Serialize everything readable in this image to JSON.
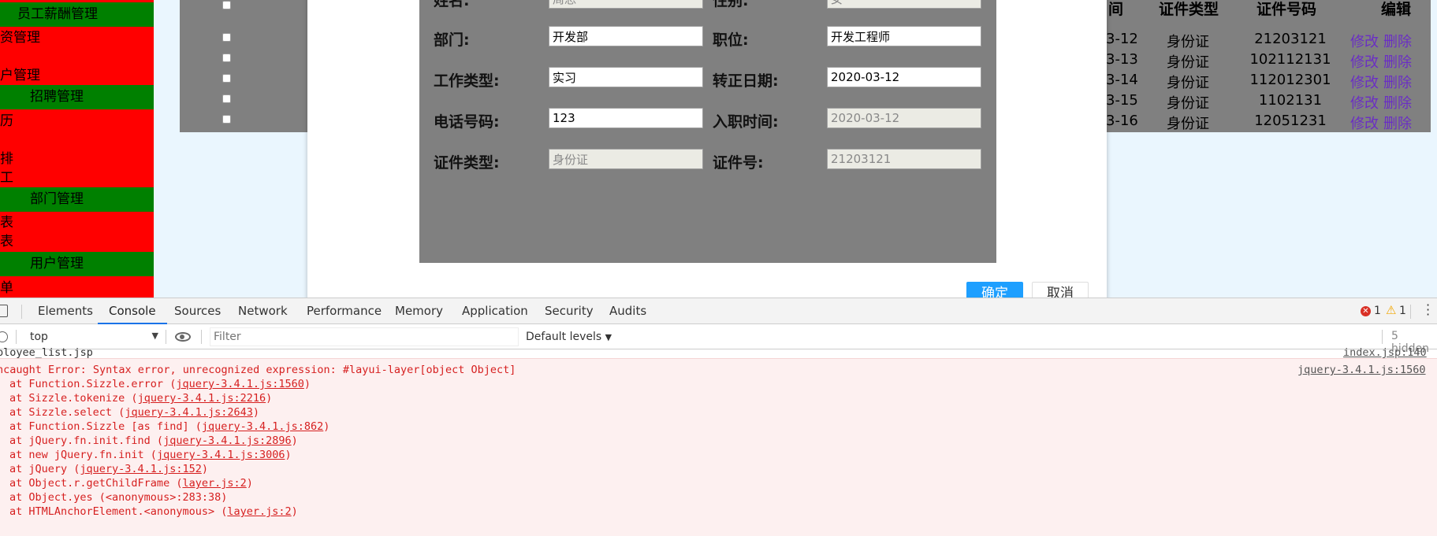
{
  "sidebar": {
    "items": [
      {
        "label": "员工薪酬管理",
        "type": "group"
      },
      {
        "label": "资管理",
        "type": "item"
      },
      {
        "label": "",
        "type": "item"
      },
      {
        "label": "户管理",
        "type": "item"
      },
      {
        "label": "招聘管理",
        "type": "group"
      },
      {
        "label": "历",
        "type": "item"
      },
      {
        "label": "",
        "type": "item"
      },
      {
        "label": "排",
        "type": "item"
      },
      {
        "label": "工",
        "type": "item"
      },
      {
        "label": "部门管理",
        "type": "group"
      },
      {
        "label": "表",
        "type": "item"
      },
      {
        "label": "表",
        "type": "item"
      },
      {
        "label": "用户管理",
        "type": "group"
      },
      {
        "label": "单",
        "type": "item"
      }
    ]
  },
  "table": {
    "headers": {
      "date_tail": "间",
      "id_type": "证件类型",
      "id_no": "证件号码",
      "edit": "编辑"
    },
    "rows": [
      {
        "date_tail": "3-12",
        "id_type": "身份证",
        "id_no": "21203121",
        "edit": "修改",
        "del": "删除"
      },
      {
        "date_tail": "3-13",
        "id_type": "身份证",
        "id_no": "102112131",
        "edit": "修改",
        "del": "删除"
      },
      {
        "date_tail": "3-14",
        "id_type": "身份证",
        "id_no": "112012301",
        "edit": "修改",
        "del": "删除"
      },
      {
        "date_tail": "3-15",
        "id_type": "身份证",
        "id_no": "1102131",
        "edit": "修改",
        "del": "删除"
      },
      {
        "date_tail": "3-16",
        "id_type": "身份证",
        "id_no": "12051231",
        "edit": "修改",
        "del": "删除"
      }
    ]
  },
  "form": {
    "name_label": "姓名:",
    "name_value": "周恐",
    "gender_label": "性别:",
    "gender_value": "女",
    "dept_label": "部门:",
    "dept_value": "开发部",
    "position_label": "职位:",
    "position_value": "开发工程师",
    "worktype_label": "工作类型:",
    "worktype_value": "实习",
    "regular_label": "转正日期:",
    "regular_value": "2020-03-12",
    "phone_label": "电话号码:",
    "phone_value": "123",
    "hire_label": "入职时间:",
    "hire_value": "2020-03-12",
    "idtype_label": "证件类型:",
    "idtype_value": "身份证",
    "idno_label": "证件号:",
    "idno_value": "21203121",
    "ok_label": "确定",
    "cancel_label": "取消"
  },
  "devtools": {
    "tabs": [
      "Elements",
      "Console",
      "Sources",
      "Network",
      "Performance",
      "Memory",
      "Application",
      "Security",
      "Audits"
    ],
    "active_tab": "Console",
    "error_count": "1",
    "warning_count": "1",
    "context": "top",
    "filter_placeholder": "Filter",
    "levels": "Default levels",
    "hidden": "5 hidden",
    "prev_line": "ployee_list.jsp",
    "prev_link": "index.jsp:140",
    "error_message": "ncaught Error: Syntax error, unrecognized expression: #layui-layer[object Object]",
    "error_link": "jquery-3.4.1.js:1560",
    "stack": [
      {
        "text": "at Function.Sizzle.error (",
        "link": "jquery-3.4.1.js:1560",
        "end": ")"
      },
      {
        "text": "at Sizzle.tokenize (",
        "link": "jquery-3.4.1.js:2216",
        "end": ")"
      },
      {
        "text": "at Sizzle.select (",
        "link": "jquery-3.4.1.js:2643",
        "end": ")"
      },
      {
        "text": "at Function.Sizzle [as find] (",
        "link": "jquery-3.4.1.js:862",
        "end": ")"
      },
      {
        "text": "at jQuery.fn.init.find (",
        "link": "jquery-3.4.1.js:2896",
        "end": ")"
      },
      {
        "text": "at new jQuery.fn.init (",
        "link": "jquery-3.4.1.js:3006",
        "end": ")"
      },
      {
        "text": "at jQuery (",
        "link": "jquery-3.4.1.js:152",
        "end": ")"
      },
      {
        "text": "at Object.r.getChildFrame (",
        "link": "layer.js:2",
        "end": ")"
      },
      {
        "text": "at Object.yes (<anonymous>:283:38)",
        "link": "",
        "end": ""
      },
      {
        "text": "at HTMLAnchorElement.<anonymous> (",
        "link": "layer.js:2",
        "end": ")"
      }
    ]
  },
  "colors": {
    "sidebar_bg": "#ff0000",
    "sidebar_group": "#008000",
    "page_bg": "#eaf6fe",
    "gray_panel": "#808080",
    "ok_button": "#1e9fff",
    "error_text": "#d61f1f",
    "error_bg": "#fdf0f0",
    "link_purple": "#6a2ec4",
    "devtools_accent": "#1a73e8"
  }
}
